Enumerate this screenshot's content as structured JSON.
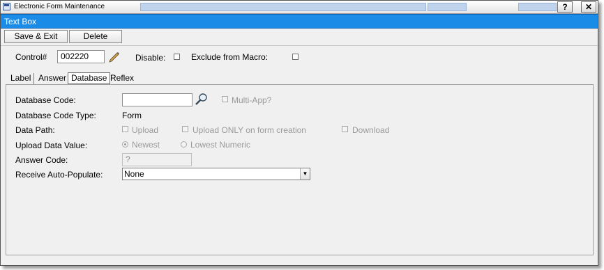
{
  "window": {
    "title": "Electronic Form Maintenance",
    "help_label": "?",
    "close_label": "✕"
  },
  "control_type": "Text Box",
  "toolbar": {
    "save_exit_label": "Save & Exit",
    "delete_label": "Delete"
  },
  "header_fields": {
    "control_label": "Control#",
    "control_value": "002220",
    "disable_label": "Disable:",
    "exclude_label": "Exclude from Macro:"
  },
  "tabs": [
    "Label",
    "Answer",
    "Database",
    "Reflex"
  ],
  "active_tab": "Database",
  "database": {
    "code_label": "Database Code:",
    "code_value": "",
    "multi_app_label": "Multi-App?",
    "code_type_label": "Database Code Type:",
    "code_type_value": "Form",
    "data_path_label": "Data Path:",
    "upload_label": "Upload",
    "upload_only_label": "Upload ONLY on form creation",
    "download_label": "Download",
    "upload_value_label": "Upload Data Value:",
    "newest_label": "Newest",
    "lowest_label": "Lowest Numeric",
    "answer_code_label": "Answer Code:",
    "answer_code_value": "?",
    "auto_populate_label": "Receive Auto-Populate:",
    "auto_populate_value": "None"
  },
  "icons": {
    "pencil": "pencil-icon",
    "search": "magnifier-icon",
    "dropdown": "chevron-down-icon"
  },
  "colors": {
    "accent_bar": "#1a8ce8"
  }
}
